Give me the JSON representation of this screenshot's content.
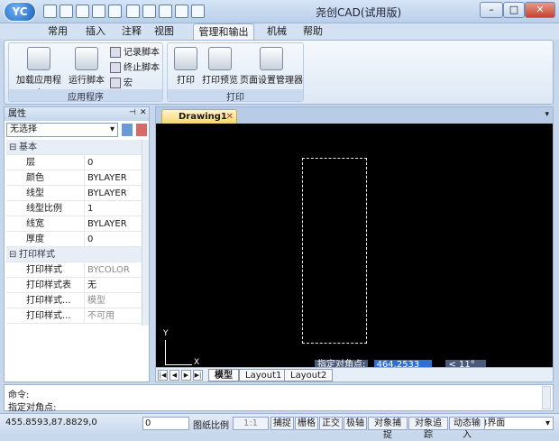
{
  "window": {
    "title": "尧创CAD(试用版)",
    "logo": "YC",
    "min": "–",
    "max": "□",
    "close": "✕"
  },
  "tabs": [
    "常用",
    "插入",
    "注释",
    "视图",
    "管理和输出",
    "机械",
    "帮助"
  ],
  "ribbon": {
    "groups": [
      {
        "label": "应用程序",
        "buttons": [
          "加载应用程序",
          "运行脚本"
        ],
        "small": [
          "记录脚本",
          "终止脚本",
          "宏"
        ]
      },
      {
        "label": "打印",
        "buttons": [
          "打印",
          "打印预览",
          "页面设置管理器"
        ]
      }
    ]
  },
  "properties": {
    "title": "属性",
    "selection": "无选择",
    "rows": [
      {
        "k": "基本",
        "cat": true
      },
      {
        "k": "层",
        "v": "0"
      },
      {
        "k": "颜色",
        "v": "BYLAYER"
      },
      {
        "k": "线型",
        "v": "BYLAYER"
      },
      {
        "k": "线型比例",
        "v": "1"
      },
      {
        "k": "线宽",
        "v": "BYLAYER"
      },
      {
        "k": "厚度",
        "v": "0"
      },
      {
        "k": "打印样式",
        "cat": true
      },
      {
        "k": "打印样式",
        "v": "BYCOLOR",
        "grey": true
      },
      {
        "k": "打印样式表",
        "v": "无"
      },
      {
        "k": "打印样式...",
        "v": "模型",
        "grey": true
      },
      {
        "k": "打印样式...",
        "v": "不可用",
        "grey": true
      }
    ]
  },
  "drawing": {
    "tab": "Drawing1",
    "axis_y": "Y",
    "axis_x": "X",
    "prompt": "指定对角点:",
    "coord_value": "464.2533",
    "angle": "< 11°",
    "layout_tabs": [
      "模型",
      "Layout1",
      "Layout2"
    ],
    "nav": [
      "|◀",
      "◀",
      "▶",
      "▶|"
    ]
  },
  "command": {
    "line1": "命令:",
    "line2": "指定对角点:"
  },
  "status": {
    "coords": "455.8593,87.8829,0",
    "layer": "0",
    "scale_label": "图纸比例",
    "scale": "1:1",
    "toggles": [
      "捕捉",
      "栅格",
      "正交",
      "极轴",
      "对象捕捉",
      "对象追踪",
      "动态输入"
    ],
    "interface": "V8界面"
  }
}
